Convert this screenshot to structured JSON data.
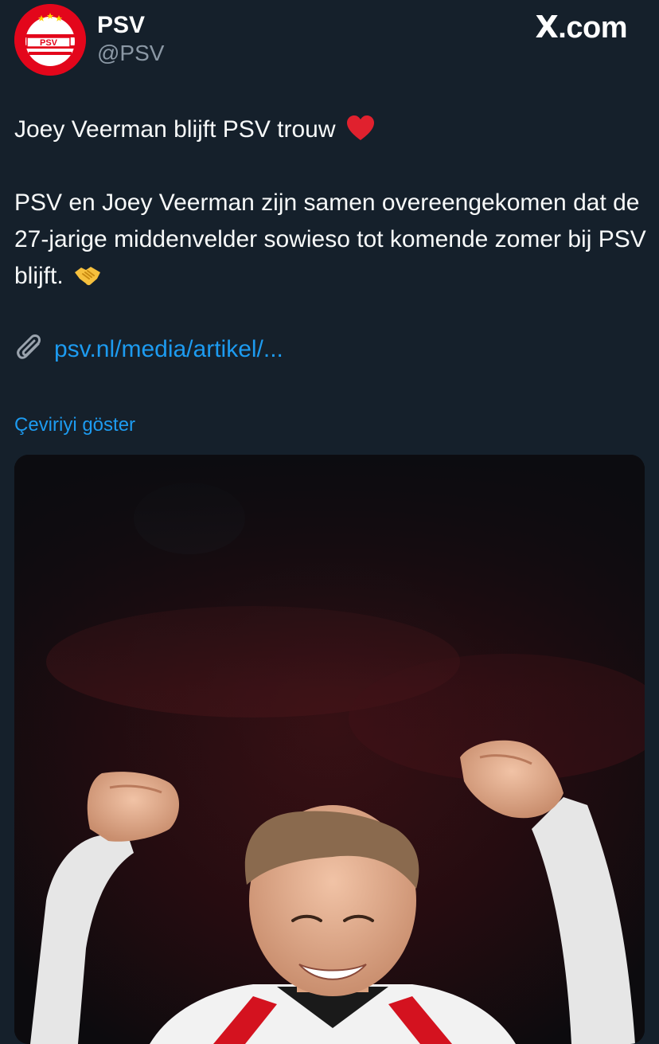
{
  "header": {
    "display_name": "PSV",
    "handle": "@PSV",
    "avatar_icon": "psv-logo-icon",
    "brand": "X.com",
    "brand_x": "X",
    "brand_rest": ".com"
  },
  "tweet": {
    "line1": "Joey Veerman blijft PSV trouw",
    "line1_emoji": "red-heart-emoji",
    "paragraph2": "PSV en Joey Veerman zijn samen overeengekomen dat de 27-jarige middenvelder sowieso tot komende zomer bij PSV blijft.",
    "paragraph2_emoji": "handshake-emoji",
    "link_icon": "paperclip-icon",
    "link_text": "psv.nl/media/artikel/..."
  },
  "translate_label": "Çeviriyi göster",
  "media": {
    "icon": "player-photo"
  },
  "colors": {
    "background": "#15202b",
    "link": "#1d9bf0",
    "muted": "#8b98a5",
    "psv_red": "#e3061b"
  }
}
